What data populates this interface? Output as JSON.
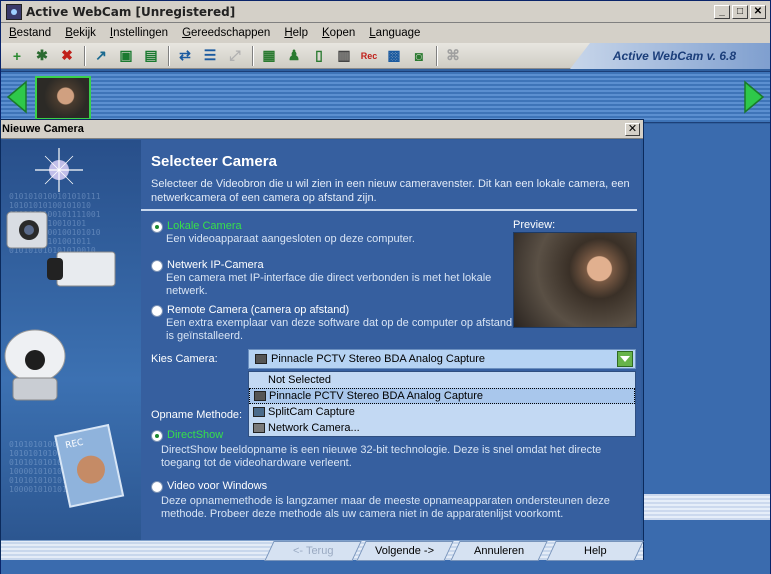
{
  "app": {
    "title": "Active WebCam [Unregistered]",
    "brand": "Active WebCam v. 6.8",
    "window_buttons": [
      "_",
      "□",
      "✕"
    ]
  },
  "menu": [
    "Bestand",
    "Bekijk",
    "Instellingen",
    "Gereedschappen",
    "Help",
    "Kopen",
    "Language"
  ],
  "toolbar_icons": [
    "add-camera-icon",
    "camera-settings-icon",
    "delete-camera-icon",
    "open-icon",
    "save-icon",
    "save-all-icon",
    "swap-icon",
    "list-icon",
    "fullscreen-icon",
    "monitor-icon",
    "users-icon",
    "document-icon",
    "film-icon",
    "record-icon",
    "snapshot-grid-icon",
    "photo-icon",
    "network-icon"
  ],
  "toolbar_record_label": "Rec",
  "dialog": {
    "title": "Nieuwe Camera",
    "close": "✕",
    "heading": "Selecteer Camera",
    "intro": "Selecteer de Videobron die u wil zien in een nieuw cameravenster. Dit kan een lokale camera, een netwerkcamera of een camera op afstand zijn.",
    "preview_label": "Preview:",
    "sources": [
      {
        "label": "Lokale Camera",
        "desc": "Een videoapparaat aangesloten op deze computer.",
        "selected": true
      },
      {
        "label": "Netwerk IP-Camera",
        "desc": "Een camera met IP-interface die direct verbonden is met het lokale netwerk.",
        "selected": false
      },
      {
        "label": "Remote Camera (camera op afstand)",
        "desc": "Een extra exemplaar van deze software dat op de computer op afstand is geïnstalleerd.",
        "selected": false
      }
    ],
    "kies_camera_label": "Kies Camera:",
    "kies_camera_value": "Pinnacle PCTV Stereo BDA Analog Capture",
    "camera_options": [
      "Not Selected",
      "Pinnacle PCTV Stereo BDA Analog Capture",
      "SplitCam Capture",
      "Network Camera..."
    ],
    "opname_label": "Opname Methode:",
    "methods": [
      {
        "label": "DirectShow",
        "desc": "DirectShow beeldopname is een nieuwe 32-bit technologie. Deze is snel omdat het directe toegang tot de videohardware verleent.",
        "selected": true
      },
      {
        "label": "Video voor Windows",
        "desc": "Deze opnamemethode is langzamer maar de meeste opnameapparaten ondersteunen deze methode. Probeer deze methode als uw camera niet in de apparatenlijst voorkomt.",
        "selected": false
      }
    ],
    "buttons": {
      "back": "<- Terug",
      "next": "Volgende ->",
      "cancel": "Annuleren",
      "help": "Help"
    }
  },
  "colors": {
    "accent_green": "#36e04a",
    "window_blue": "#2f5f9e"
  }
}
